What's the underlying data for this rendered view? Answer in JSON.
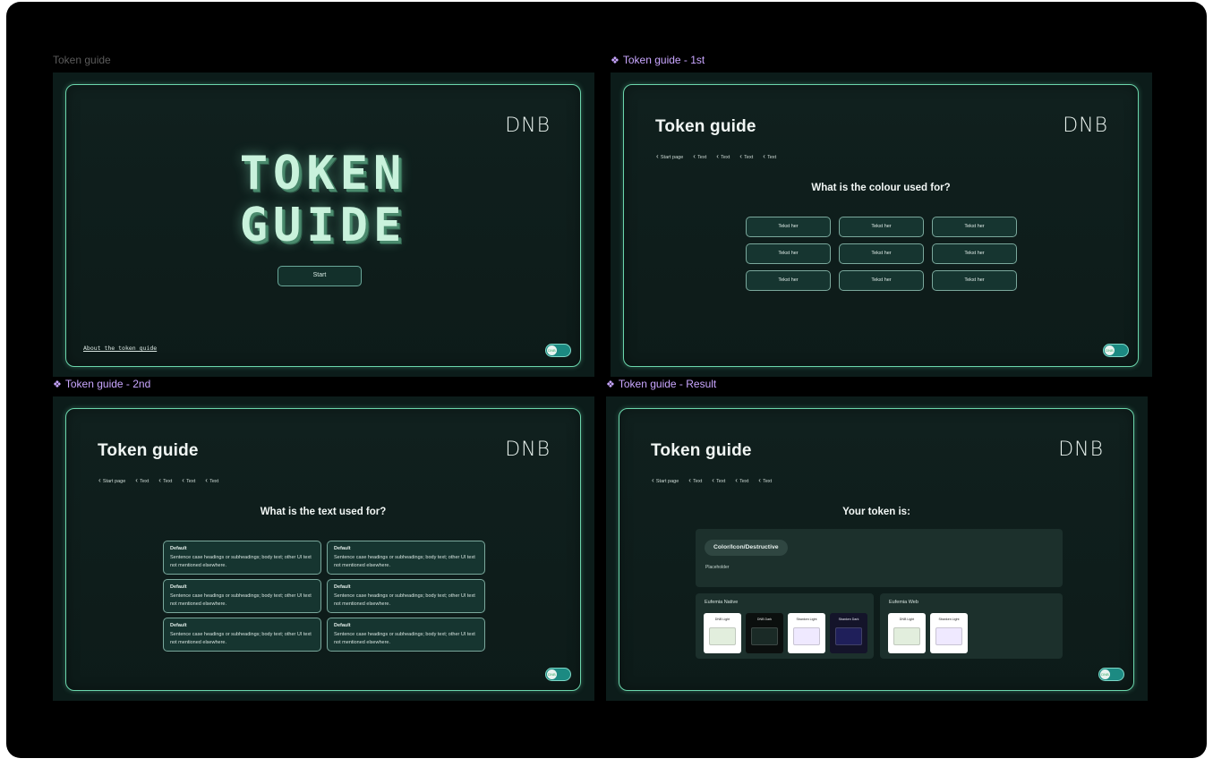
{
  "labels": {
    "f1": "Token guide",
    "f2": "Token guide - 1st",
    "f3": "Token guide - 2nd",
    "f4": "Token guide - Result",
    "diamond": "❖"
  },
  "brand": {
    "logo": "DNB"
  },
  "intro": {
    "title_line1": "TOKEN",
    "title_line2": "GUIDE",
    "start": "Start",
    "about": "About the token guide"
  },
  "common": {
    "page_title": "Token guide",
    "breadcrumbs": [
      "Start page",
      "Text",
      "Text",
      "Text",
      "Text"
    ]
  },
  "first": {
    "question": "What is the colour used for?",
    "buttons": [
      "Tekst her",
      "Tekst her",
      "Tekst her",
      "Tekst her",
      "Tekst her",
      "Tekst her",
      "Tekst her",
      "Tekst her",
      "Tekst her"
    ]
  },
  "second": {
    "question": "What is the text used for?",
    "options": [
      {
        "title": "Default",
        "desc": "Sentence case headings or subheadings; body text; other UI text not mentioned elsewhere."
      },
      {
        "title": "Default",
        "desc": "Sentence case headings or subheadings; body text; other UI text not mentioned elsewhere."
      },
      {
        "title": "Default",
        "desc": "Sentence case headings or subheadings; body text; other UI text not mentioned elsewhere."
      },
      {
        "title": "Default",
        "desc": "Sentence case headings or subheadings; body text; other UI text not mentioned elsewhere."
      },
      {
        "title": "Default",
        "desc": "Sentence case headings or subheadings; body text; other UI text not mentioned elsewhere."
      },
      {
        "title": "Default",
        "desc": "Sentence case headings or subheadings; body text; other UI text not mentioned elsewhere."
      }
    ]
  },
  "result": {
    "heading": "Your token is:",
    "token": "Color/Icon/Destructive",
    "placeholder": "Placeholder",
    "native": {
      "label": "Eufemia Native",
      "swatches": [
        {
          "name": "DNB Light",
          "bg": "#ffffff",
          "text": "#222222",
          "chip": "#e2eedd"
        },
        {
          "name": "DNB Dark",
          "bg": "#0b0f0e",
          "text": "#e6e6e6",
          "chip": "#1a2a26"
        },
        {
          "name": "Sbanken Light",
          "bg": "#ffffff",
          "text": "#222222",
          "chip": "#efe9ff"
        },
        {
          "name": "Sbanken Dark",
          "bg": "#14142a",
          "text": "#e6e6f2",
          "chip": "#1f1f5a"
        }
      ]
    },
    "web": {
      "label": "Eufemia Web",
      "swatches": [
        {
          "name": "DNB Light",
          "bg": "#ffffff",
          "text": "#222222",
          "chip": "#e2eedd"
        },
        {
          "name": "Sbanken Light",
          "bg": "#ffffff",
          "text": "#222222",
          "chip": "#efe9ff"
        }
      ]
    }
  },
  "toggle": {
    "knob_text": "DNB"
  },
  "colors": {
    "accent": "#6bd6ac",
    "bg": "#0c1c1a",
    "component_label": "#c9a6ff"
  }
}
